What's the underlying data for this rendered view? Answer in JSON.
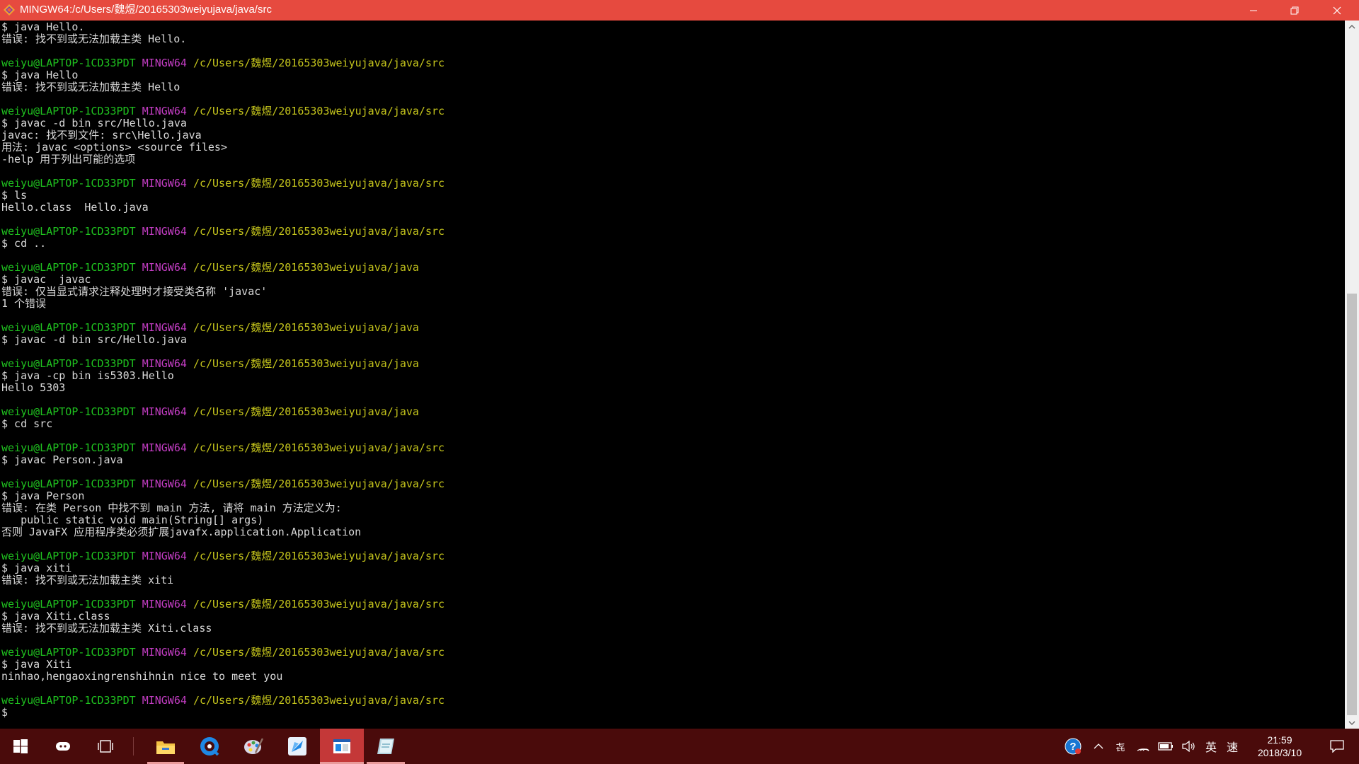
{
  "window": {
    "title": "MINGW64:/c/Users/魏煜/20165303weiyujava/java/src"
  },
  "terminal": {
    "lines": [
      [
        {
          "c": "t",
          "t": "$ java Hello."
        }
      ],
      [
        {
          "c": "t",
          "t": "错误: 找不到或无法加载主类 Hello."
        }
      ],
      [
        {
          "c": "t",
          "t": ""
        }
      ],
      [
        {
          "c": "u",
          "t": "weiyu@LAPTOP-1CD33PDT"
        },
        {
          "c": "t",
          "t": " "
        },
        {
          "c": "h",
          "t": "MINGW64"
        },
        {
          "c": "t",
          "t": " "
        },
        {
          "c": "p",
          "t": "/c/Users/魏煜/20165303weiyujava/java/src"
        }
      ],
      [
        {
          "c": "t",
          "t": "$ java Hello"
        }
      ],
      [
        {
          "c": "t",
          "t": "错误: 找不到或无法加载主类 Hello"
        }
      ],
      [
        {
          "c": "t",
          "t": ""
        }
      ],
      [
        {
          "c": "u",
          "t": "weiyu@LAPTOP-1CD33PDT"
        },
        {
          "c": "t",
          "t": " "
        },
        {
          "c": "h",
          "t": "MINGW64"
        },
        {
          "c": "t",
          "t": " "
        },
        {
          "c": "p",
          "t": "/c/Users/魏煜/20165303weiyujava/java/src"
        }
      ],
      [
        {
          "c": "t",
          "t": "$ javac -d bin src/Hello.java"
        }
      ],
      [
        {
          "c": "t",
          "t": "javac: 找不到文件: src\\Hello.java"
        }
      ],
      [
        {
          "c": "t",
          "t": "用法: javac <options> <source files>"
        }
      ],
      [
        {
          "c": "t",
          "t": "-help 用于列出可能的选项"
        }
      ],
      [
        {
          "c": "t",
          "t": ""
        }
      ],
      [
        {
          "c": "u",
          "t": "weiyu@LAPTOP-1CD33PDT"
        },
        {
          "c": "t",
          "t": " "
        },
        {
          "c": "h",
          "t": "MINGW64"
        },
        {
          "c": "t",
          "t": " "
        },
        {
          "c": "p",
          "t": "/c/Users/魏煜/20165303weiyujava/java/src"
        }
      ],
      [
        {
          "c": "t",
          "t": "$ ls"
        }
      ],
      [
        {
          "c": "t",
          "t": "Hello.class  Hello.java"
        }
      ],
      [
        {
          "c": "t",
          "t": ""
        }
      ],
      [
        {
          "c": "u",
          "t": "weiyu@LAPTOP-1CD33PDT"
        },
        {
          "c": "t",
          "t": " "
        },
        {
          "c": "h",
          "t": "MINGW64"
        },
        {
          "c": "t",
          "t": " "
        },
        {
          "c": "p",
          "t": "/c/Users/魏煜/20165303weiyujava/java/src"
        }
      ],
      [
        {
          "c": "t",
          "t": "$ cd .."
        }
      ],
      [
        {
          "c": "t",
          "t": ""
        }
      ],
      [
        {
          "c": "u",
          "t": "weiyu@LAPTOP-1CD33PDT"
        },
        {
          "c": "t",
          "t": " "
        },
        {
          "c": "h",
          "t": "MINGW64"
        },
        {
          "c": "t",
          "t": " "
        },
        {
          "c": "p",
          "t": "/c/Users/魏煜/20165303weiyujava/java"
        }
      ],
      [
        {
          "c": "t",
          "t": "$ javac  javac"
        }
      ],
      [
        {
          "c": "t",
          "t": "错误: 仅当显式请求注释处理时才接受类名称 'javac'"
        }
      ],
      [
        {
          "c": "t",
          "t": "1 个错误"
        }
      ],
      [
        {
          "c": "t",
          "t": ""
        }
      ],
      [
        {
          "c": "u",
          "t": "weiyu@LAPTOP-1CD33PDT"
        },
        {
          "c": "t",
          "t": " "
        },
        {
          "c": "h",
          "t": "MINGW64"
        },
        {
          "c": "t",
          "t": " "
        },
        {
          "c": "p",
          "t": "/c/Users/魏煜/20165303weiyujava/java"
        }
      ],
      [
        {
          "c": "t",
          "t": "$ javac -d bin src/Hello.java"
        }
      ],
      [
        {
          "c": "t",
          "t": ""
        }
      ],
      [
        {
          "c": "u",
          "t": "weiyu@LAPTOP-1CD33PDT"
        },
        {
          "c": "t",
          "t": " "
        },
        {
          "c": "h",
          "t": "MINGW64"
        },
        {
          "c": "t",
          "t": " "
        },
        {
          "c": "p",
          "t": "/c/Users/魏煜/20165303weiyujava/java"
        }
      ],
      [
        {
          "c": "t",
          "t": "$ java -cp bin is5303.Hello"
        }
      ],
      [
        {
          "c": "t",
          "t": "Hello 5303"
        }
      ],
      [
        {
          "c": "t",
          "t": ""
        }
      ],
      [
        {
          "c": "u",
          "t": "weiyu@LAPTOP-1CD33PDT"
        },
        {
          "c": "t",
          "t": " "
        },
        {
          "c": "h",
          "t": "MINGW64"
        },
        {
          "c": "t",
          "t": " "
        },
        {
          "c": "p",
          "t": "/c/Users/魏煜/20165303weiyujava/java"
        }
      ],
      [
        {
          "c": "t",
          "t": "$ cd src"
        }
      ],
      [
        {
          "c": "t",
          "t": ""
        }
      ],
      [
        {
          "c": "u",
          "t": "weiyu@LAPTOP-1CD33PDT"
        },
        {
          "c": "t",
          "t": " "
        },
        {
          "c": "h",
          "t": "MINGW64"
        },
        {
          "c": "t",
          "t": " "
        },
        {
          "c": "p",
          "t": "/c/Users/魏煜/20165303weiyujava/java/src"
        }
      ],
      [
        {
          "c": "t",
          "t": "$ javac Person.java"
        }
      ],
      [
        {
          "c": "t",
          "t": ""
        }
      ],
      [
        {
          "c": "u",
          "t": "weiyu@LAPTOP-1CD33PDT"
        },
        {
          "c": "t",
          "t": " "
        },
        {
          "c": "h",
          "t": "MINGW64"
        },
        {
          "c": "t",
          "t": " "
        },
        {
          "c": "p",
          "t": "/c/Users/魏煜/20165303weiyujava/java/src"
        }
      ],
      [
        {
          "c": "t",
          "t": "$ java Person"
        }
      ],
      [
        {
          "c": "t",
          "t": "错误: 在类 Person 中找不到 main 方法, 请将 main 方法定义为:"
        }
      ],
      [
        {
          "c": "t",
          "t": "   public static void main(String[] args)"
        }
      ],
      [
        {
          "c": "t",
          "t": "否则 JavaFX 应用程序类必须扩展javafx.application.Application"
        }
      ],
      [
        {
          "c": "t",
          "t": ""
        }
      ],
      [
        {
          "c": "u",
          "t": "weiyu@LAPTOP-1CD33PDT"
        },
        {
          "c": "t",
          "t": " "
        },
        {
          "c": "h",
          "t": "MINGW64"
        },
        {
          "c": "t",
          "t": " "
        },
        {
          "c": "p",
          "t": "/c/Users/魏煜/20165303weiyujava/java/src"
        }
      ],
      [
        {
          "c": "t",
          "t": "$ java xiti"
        }
      ],
      [
        {
          "c": "t",
          "t": "错误: 找不到或无法加载主类 xiti"
        }
      ],
      [
        {
          "c": "t",
          "t": ""
        }
      ],
      [
        {
          "c": "u",
          "t": "weiyu@LAPTOP-1CD33PDT"
        },
        {
          "c": "t",
          "t": " "
        },
        {
          "c": "h",
          "t": "MINGW64"
        },
        {
          "c": "t",
          "t": " "
        },
        {
          "c": "p",
          "t": "/c/Users/魏煜/20165303weiyujava/java/src"
        }
      ],
      [
        {
          "c": "t",
          "t": "$ java Xiti.class"
        }
      ],
      [
        {
          "c": "t",
          "t": "错误: 找不到或无法加载主类 Xiti.class"
        }
      ],
      [
        {
          "c": "t",
          "t": ""
        }
      ],
      [
        {
          "c": "u",
          "t": "weiyu@LAPTOP-1CD33PDT"
        },
        {
          "c": "t",
          "t": " "
        },
        {
          "c": "h",
          "t": "MINGW64"
        },
        {
          "c": "t",
          "t": " "
        },
        {
          "c": "p",
          "t": "/c/Users/魏煜/20165303weiyujava/java/src"
        }
      ],
      [
        {
          "c": "t",
          "t": "$ java Xiti"
        }
      ],
      [
        {
          "c": "t",
          "t": "ninhao,hengaoxingrenshihnin nice to meet you"
        }
      ],
      [
        {
          "c": "t",
          "t": ""
        }
      ],
      [
        {
          "c": "u",
          "t": "weiyu@LAPTOP-1CD33PDT"
        },
        {
          "c": "t",
          "t": " "
        },
        {
          "c": "h",
          "t": "MINGW64"
        },
        {
          "c": "t",
          "t": " "
        },
        {
          "c": "p",
          "t": "/c/Users/魏煜/20165303weiyujava/java/src"
        }
      ],
      [
        {
          "c": "t",
          "t": "$"
        }
      ]
    ]
  },
  "colors": {
    "titlebar": "#e64a3f",
    "user_host": "#1fc21f",
    "shell_name": "#c33dc3",
    "path": "#c5c51c",
    "terminal_text": "#d8d8d8",
    "taskbar": "#4a0b0b"
  },
  "taskbar": {
    "apps": [
      "file-explorer-icon",
      "browser-icon",
      "paint-icon",
      "feather-app-icon",
      "terminal-app-icon",
      "notebook-app-icon"
    ],
    "tray": {
      "ime_mode": "英",
      "ime_speed": "速",
      "ime_indicator": "㐂"
    },
    "clock": {
      "time": "21:59",
      "date": "2018/3/10"
    }
  }
}
